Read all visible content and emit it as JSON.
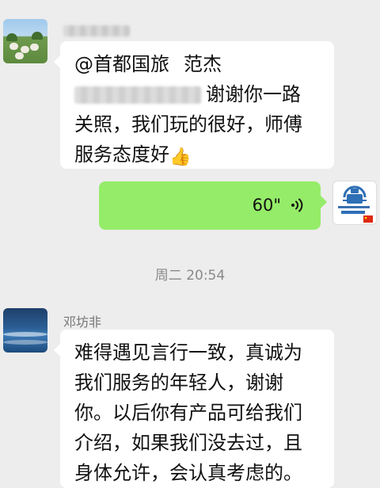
{
  "chat": {
    "messages": [
      {
        "mention": "@首都国旅",
        "mention_name": "范杰",
        "lines": [
          "谢谢你一路",
          "关照，我们玩的很好，师傅",
          "服务态度好"
        ],
        "emoji": "thumbs-up-icon"
      },
      {
        "voice_duration": "60\""
      }
    ],
    "timestamp": "周二 20:54",
    "sender_name": "邓坊非",
    "message3_lines": [
      "难得遇见言行一致，真诚为",
      "我们服务的年轻人，谢谢",
      "你。以后你有产品可给我们",
      "介绍，如果我们没去过，且",
      "身体允许，会认真考虑的。"
    ]
  },
  "colors": {
    "background": "#ededed",
    "incoming_bubble": "#ffffff",
    "outgoing_bubble": "#95ec69",
    "agency_logo": "#2f6fb5",
    "flag_red": "#de2910"
  }
}
